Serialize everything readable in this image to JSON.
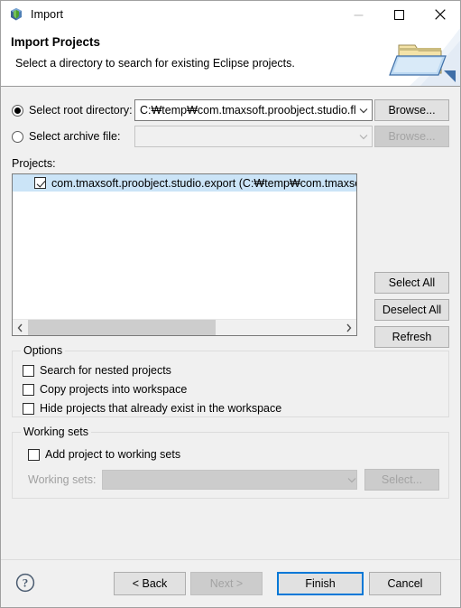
{
  "window": {
    "title": "Import",
    "icon": "eclipse-import-cube-icon",
    "controls": {
      "minimize": "minimize-icon",
      "maximize": "maximize-icon",
      "close": "close-icon"
    }
  },
  "header": {
    "title": "Import Projects",
    "description": "Select a directory to search for existing Eclipse projects.",
    "graphic": "open-folder-icon"
  },
  "source": {
    "root_directory": {
      "label": "Select root directory:",
      "selected": true,
      "value": "C:₩temp₩com.tmaxsoft.proobject.studio.fl",
      "browse_label": "Browse...",
      "browse_enabled": true
    },
    "archive_file": {
      "label": "Select archive file:",
      "selected": false,
      "value": "",
      "browse_label": "Browse...",
      "browse_enabled": false
    }
  },
  "projects": {
    "label": "Projects:",
    "items": [
      {
        "text": "com.tmaxsoft.proobject.studio.export (C:₩temp₩com.tmaxsoft.p",
        "checked": true,
        "selected": true
      }
    ],
    "buttons": {
      "select_all": "Select All",
      "deselect_all": "Deselect All",
      "refresh": "Refresh"
    },
    "scroll": {
      "left_arrow": "chevron-left-icon",
      "right_arrow": "chevron-right-icon",
      "thumb_percent": 60
    }
  },
  "options": {
    "title": "Options",
    "items": [
      {
        "label": "Search for nested projects",
        "checked": false
      },
      {
        "label": "Copy projects into workspace",
        "checked": false
      },
      {
        "label": "Hide projects that already exist in the workspace",
        "checked": false
      }
    ]
  },
  "working_sets": {
    "title": "Working sets",
    "add_checkbox": {
      "label": "Add project to working sets",
      "checked": false
    },
    "combo_label": "Working sets:",
    "combo_value": "",
    "select_label": "Select...",
    "enabled": false
  },
  "footer": {
    "help": "help-icon",
    "back": "< Back",
    "next": "Next >",
    "finish": "Finish",
    "cancel": "Cancel",
    "next_enabled": false,
    "default_button": "Finish"
  },
  "colors": {
    "accent": "#0078d7",
    "selection": "#cbe4f7",
    "dialog_bg": "#f0f0f0",
    "header_bg": "#ffffff",
    "button_bg": "#e1e1e1",
    "disabled_text": "#a3a3a3"
  }
}
